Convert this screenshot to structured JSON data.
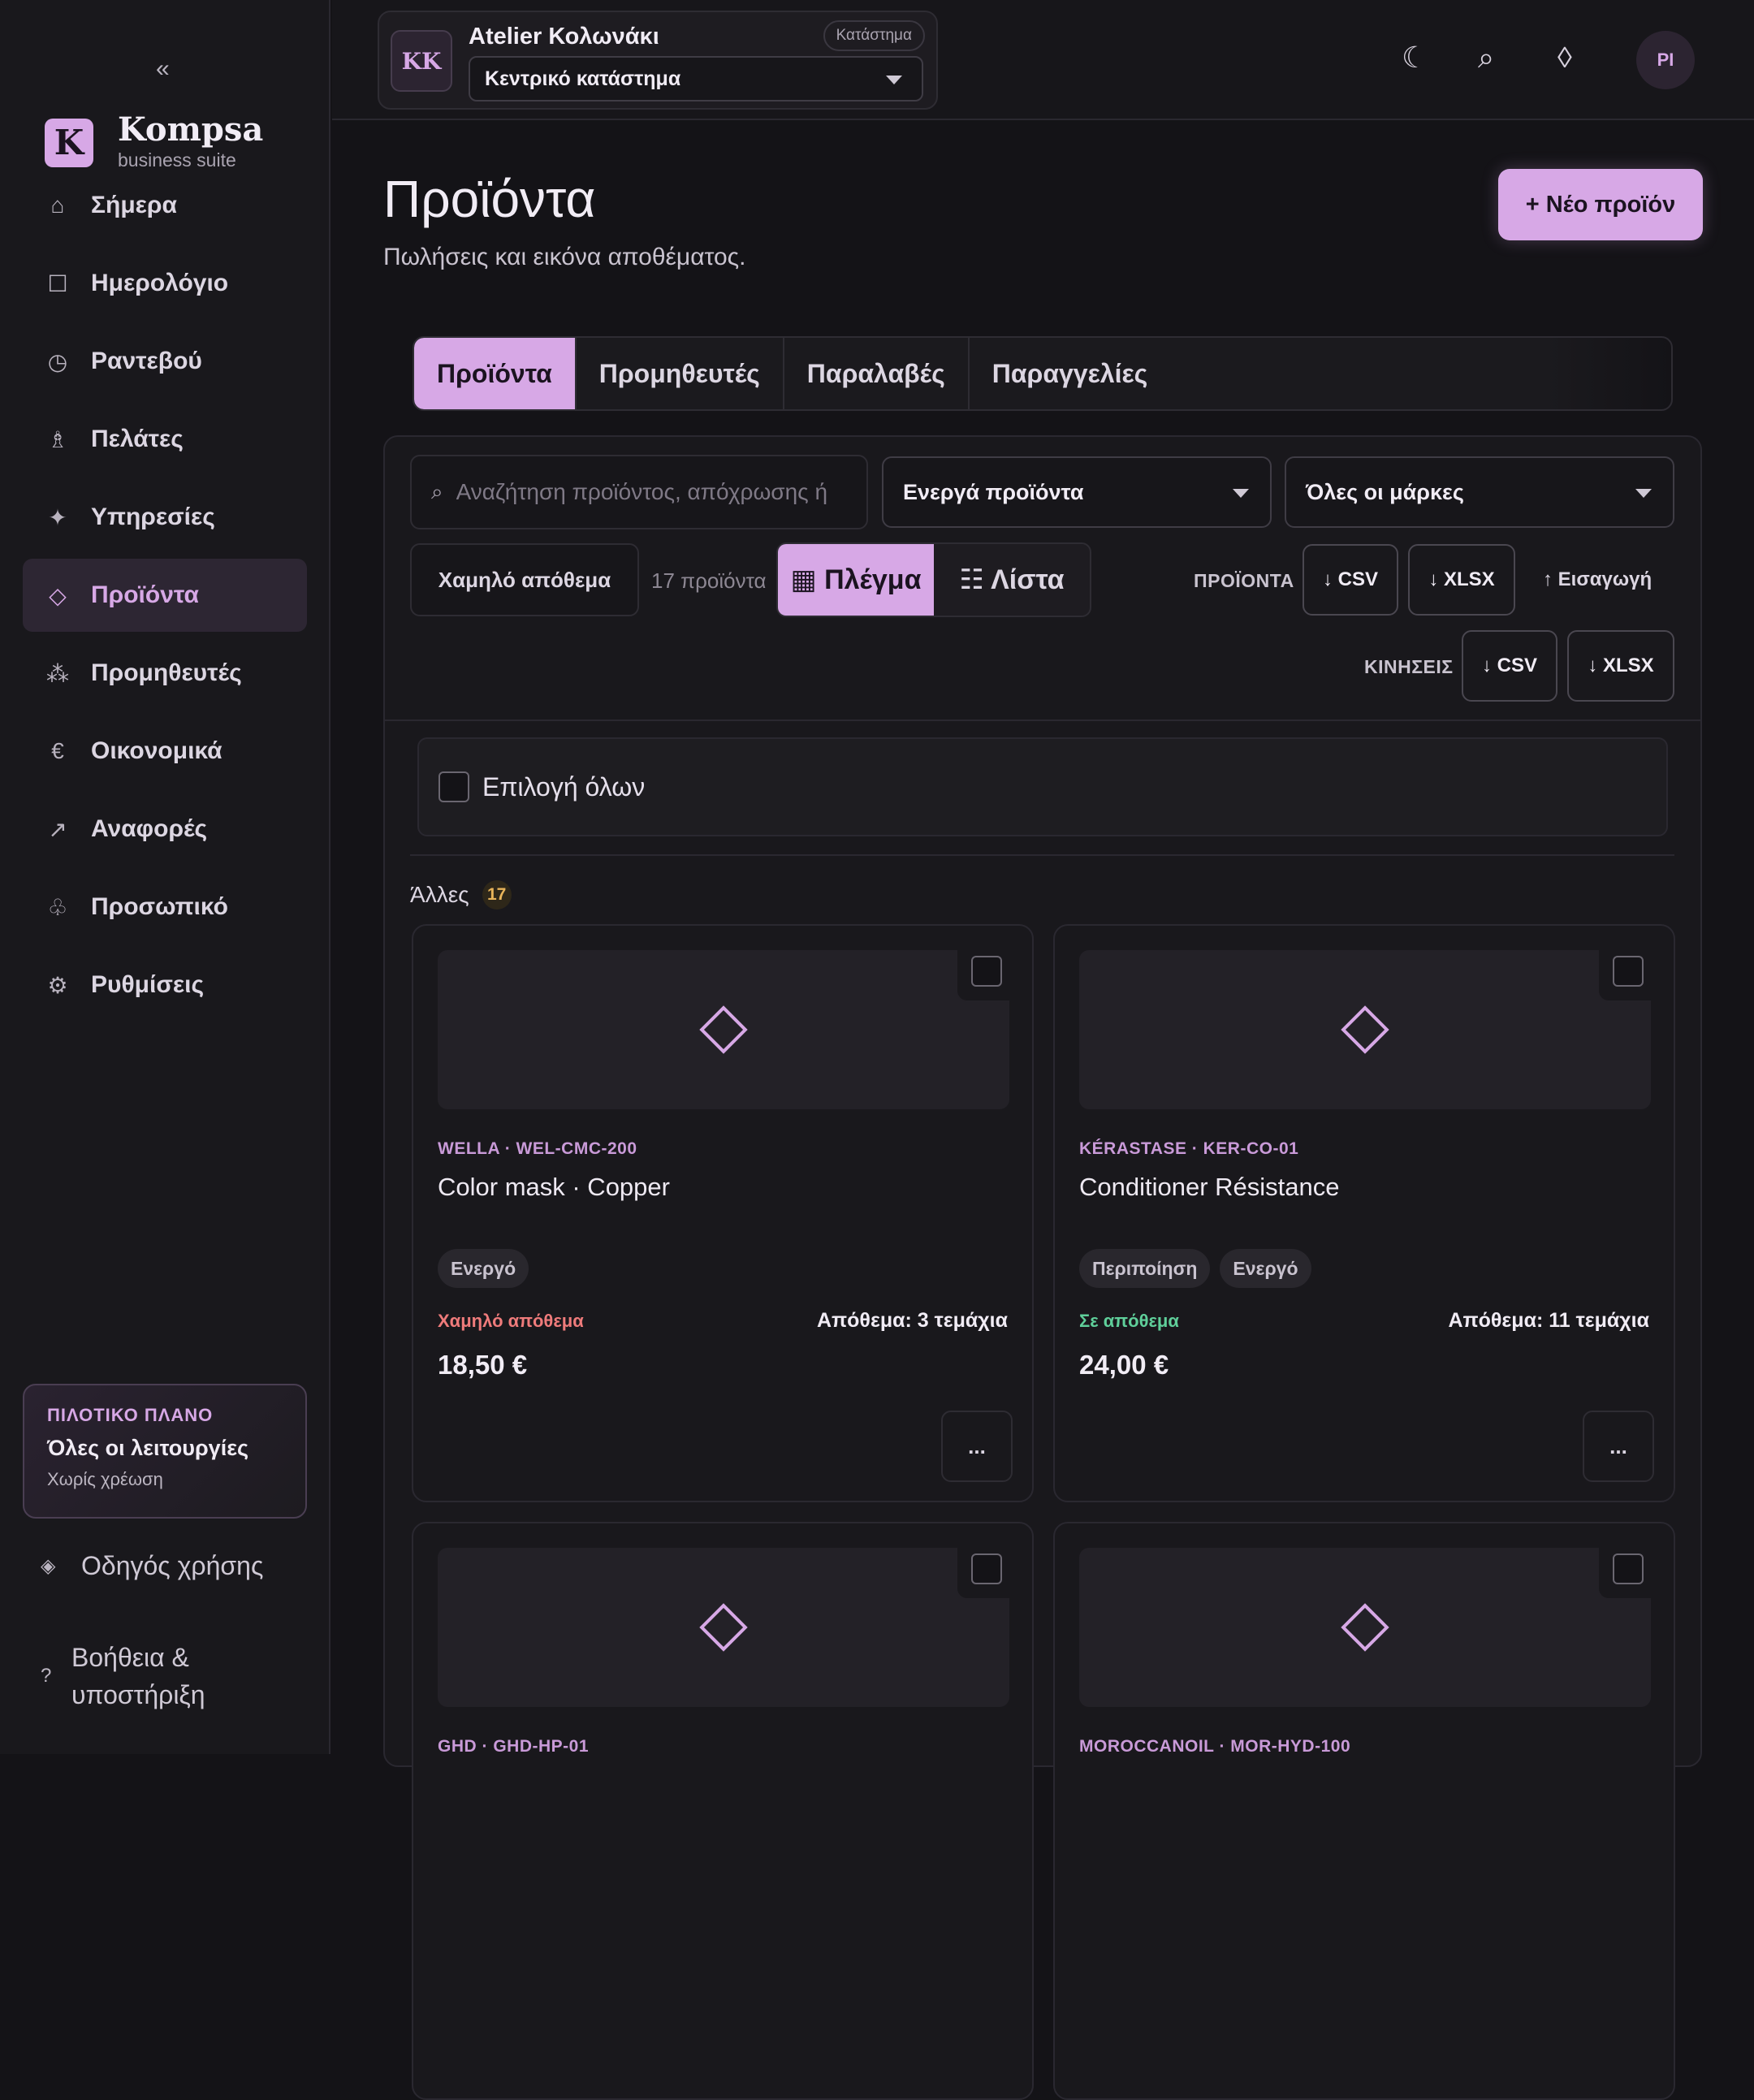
{
  "sidebar": {
    "collapse_icon": "«",
    "brand_letter": "K",
    "brand_name": "Kompsa",
    "brand_sub": "business suite",
    "items": [
      {
        "label": "Σήμερα",
        "icon": "⌂",
        "icon_name": "home-icon"
      },
      {
        "label": "Ημερολόγιο",
        "icon": "☐",
        "icon_name": "calendar-icon"
      },
      {
        "label": "Ραντεβού",
        "icon": "◷",
        "icon_name": "clock-icon"
      },
      {
        "label": "Πελάτες",
        "icon": "♗",
        "icon_name": "clients-icon"
      },
      {
        "label": "Υπηρεσίες",
        "icon": "✦",
        "icon_name": "sparkle-icon"
      },
      {
        "label": "Προϊόντα",
        "icon": "◇",
        "icon_name": "diamond-icon",
        "active": true
      },
      {
        "label": "Προμηθευτές",
        "icon": "⁂",
        "icon_name": "suppliers-icon"
      },
      {
        "label": "Οικονομικά",
        "icon": "€",
        "icon_name": "euro-icon"
      },
      {
        "label": "Αναφορές",
        "icon": "↗",
        "icon_name": "reports-icon"
      },
      {
        "label": "Προσωπικό",
        "icon": "♧",
        "icon_name": "staff-icon"
      },
      {
        "label": "Ρυθμίσεις",
        "icon": "⚙",
        "icon_name": "gear-icon"
      }
    ],
    "plan": {
      "kicker": "ΠΙΛΟΤΙΚΟ ΠΛΑΝΟ",
      "title": "Όλες οι λειτουργίες",
      "sub": "Χωρίς χρέωση"
    },
    "guide": {
      "icon": "◈",
      "label": "Οδηγός χρήσης"
    },
    "help": {
      "icon": "?",
      "label_line1": "Βοήθεια &",
      "label_line2": "υποστήριξη"
    }
  },
  "topbar": {
    "store_initials": "KK",
    "store_name": "Atelier Κολωνάκι",
    "store_badge": "Κατάστημα",
    "store_select": "Κεντρικό κατάστημα",
    "icons": {
      "moon": "☾",
      "search": "⌕",
      "diamond": "◊"
    },
    "user_initials": "PI"
  },
  "page": {
    "title": "Προϊόντα",
    "subtitle": "Πωλήσεις και εικόνα αποθέματος.",
    "new_button": "+ Νέο προϊόν"
  },
  "tabs": [
    "Προϊόντα",
    "Προμηθευτές",
    "Παραλαβές",
    "Παραγγελίες"
  ],
  "filters": {
    "search_placeholder": "Αναζήτηση προϊόντος, απόχρωσης ή SKU",
    "status_select": "Ενεργά προϊόντα",
    "brand_select": "Όλες οι μάρκες",
    "low_stock": "Χαμηλό απόθεμα",
    "count": "17 προϊόντα",
    "view_grid": "▦ Πλέγμα",
    "view_list": "☷ Λίστα"
  },
  "exports": {
    "products_label": "ΠΡΟΪΟΝΤΑ",
    "movements_label": "ΚΙΝΗΣΕΙΣ",
    "csv": "↓ CSV",
    "xlsx": "↓ XLSX",
    "import": "↑ Εισαγωγή"
  },
  "select_all": "Επιλογή όλων",
  "group": {
    "name": "Άλλες",
    "count": "17"
  },
  "colors": {
    "accent": "#d7a8e6",
    "low_stock": "#ef7b7b",
    "in_stock": "#5fcf9a"
  },
  "products": [
    {
      "meta": "WELLA · WEL-CMC-200",
      "name": "Color mask · Copper",
      "chips": [
        "Ενεργό"
      ],
      "stock_status": "Χαμηλό απόθεμα",
      "stock_kind": "low",
      "stock_qty": "Απόθεμα: 3 τεμάχια",
      "price": "18,50 €",
      "more": "..."
    },
    {
      "meta": "KÉRASTASE · KER-CO-01",
      "name": "Conditioner Résistance",
      "chips": [
        "Περιποίηση",
        "Ενεργό"
      ],
      "stock_status": "Σε απόθεμα",
      "stock_kind": "ok",
      "stock_qty": "Απόθεμα: 11 τεμάχια",
      "price": "24,00 €",
      "more": "..."
    },
    {
      "meta": "GHD · GHD-HP-01",
      "name": "",
      "chips": [],
      "stock_status": "",
      "stock_kind": "",
      "stock_qty": "",
      "price": "",
      "more": ""
    },
    {
      "meta": "MOROCCANOIL · MOR-HYD-100",
      "name": "",
      "chips": [],
      "stock_status": "",
      "stock_kind": "",
      "stock_qty": "",
      "price": "",
      "more": ""
    }
  ]
}
